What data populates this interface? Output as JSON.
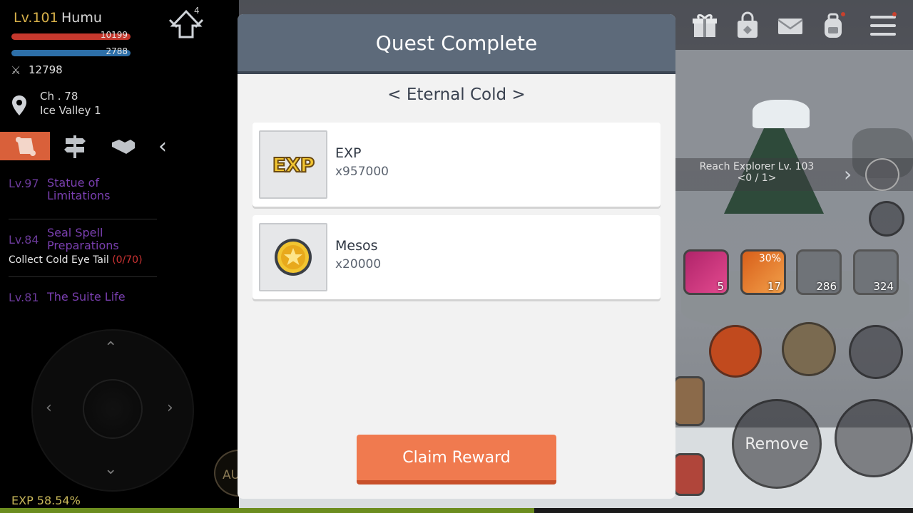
{
  "player": {
    "level_label": "Lv.101",
    "name": "Humu",
    "hp": "10199",
    "mp": "2788",
    "power": "12798",
    "levelup_count": "4"
  },
  "location": {
    "channel": "Ch . 78",
    "map": "Ice Valley 1"
  },
  "quests": [
    {
      "level": "Lv.97",
      "name": "Statue of Limitations"
    },
    {
      "level": "Lv.84",
      "name": "Seal Spell Preparations",
      "objective": "Collect Cold Eye Tail",
      "progress": "(0/70)"
    },
    {
      "level": "Lv.81",
      "name": "The Suite Life"
    }
  ],
  "auto_label": "AU",
  "exp": {
    "label": "EXP 58.54%",
    "percent": 58.54
  },
  "tracker": {
    "text": "Reach Explorer Lv. 103 <0 / 1>"
  },
  "skills": {
    "skill1_count": "5",
    "skill2_count": "17",
    "skill2_pct": "30%",
    "potion_red": "286",
    "potion_blue": "324"
  },
  "remove_label": "Remove",
  "modal": {
    "title": "Quest Complete",
    "quest_name": "< Eternal Cold >",
    "rewards": [
      {
        "name": "EXP",
        "qty": "x957000",
        "icon": "exp-icon"
      },
      {
        "name": "Mesos",
        "qty": "x20000",
        "icon": "meso-coin-icon"
      }
    ],
    "claim_label": "Claim Reward",
    "exp_icon_text": "EXP"
  },
  "colors": {
    "modal_header": "#5d6a7a",
    "claim_button": "#f07a4f",
    "hp_bar": "#c5382d",
    "mp_bar": "#2d6fa8",
    "exp_bar": "#6c8d1f",
    "quest_name": "#7a3fb0"
  }
}
